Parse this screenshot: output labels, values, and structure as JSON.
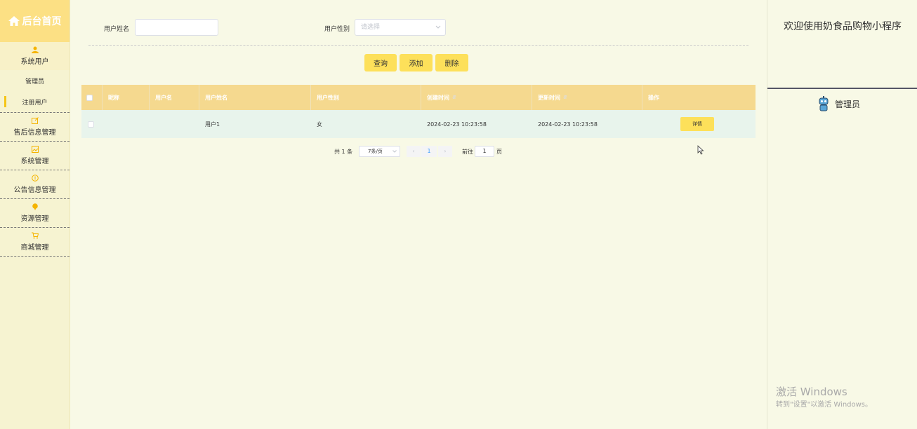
{
  "sidebar": {
    "logo": "后台首页",
    "groups": [
      {
        "label": "系统用户",
        "icon": "user-icon",
        "items": [
          "管理员",
          "注册用户"
        ]
      },
      {
        "label": "售后信息管理",
        "icon": "edit-icon"
      },
      {
        "label": "系统管理",
        "icon": "image-icon"
      },
      {
        "label": "公告信息管理",
        "icon": "info-circle-icon"
      },
      {
        "label": "资源管理",
        "icon": "pin-icon"
      },
      {
        "label": "商城管理",
        "icon": "cart-icon"
      }
    ]
  },
  "search": {
    "name_label": "用户姓名",
    "name_value": "",
    "gender_label": "用户性别",
    "gender_placeholder": "请选择"
  },
  "buttons": {
    "query": "查询",
    "add": "添加",
    "delete": "删除"
  },
  "table": {
    "headers": [
      "昵称",
      "用户名",
      "用户姓名",
      "用户性别",
      "创建时间",
      "更新时间",
      "操作"
    ],
    "rows": [
      {
        "nickname": "",
        "username": "",
        "realname": "用户1",
        "gender": "女",
        "created": "2024-02-23 10:23:58",
        "updated": "2024-02-23 10:23:58",
        "action": "详情"
      }
    ]
  },
  "pagination": {
    "total": "共 1 条",
    "page_size": "7条/页",
    "current": "1",
    "goto_prefix": "前往",
    "goto_value": "1",
    "goto_suffix": "页"
  },
  "right": {
    "welcome": "欢迎使用奶食品购物小程序",
    "role": "管理员"
  },
  "watermark": {
    "title": "激活 Windows",
    "subtitle": "转到\"设置\"以激活 Windows。"
  },
  "colors": {
    "accent": "#fde05a",
    "header": "#f5d98f",
    "sidebar": "#f6f3d1",
    "background": "#f8f9e6"
  }
}
